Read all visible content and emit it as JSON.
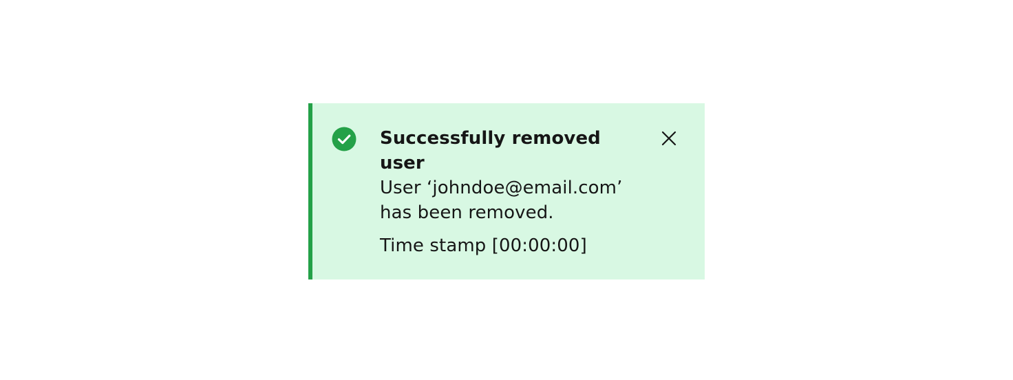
{
  "notification": {
    "kind": "success",
    "title": "Successfully removed user",
    "subtitle": "User ‘johndoe@email.com’ has been removed.",
    "caption": "Time stamp [00:00:00]",
    "status_icon": "checkmark-filled-icon",
    "close_icon": "close-icon",
    "colors": {
      "background": "#d8f8e3",
      "accent": "#24a148",
      "text": "#161616"
    }
  }
}
